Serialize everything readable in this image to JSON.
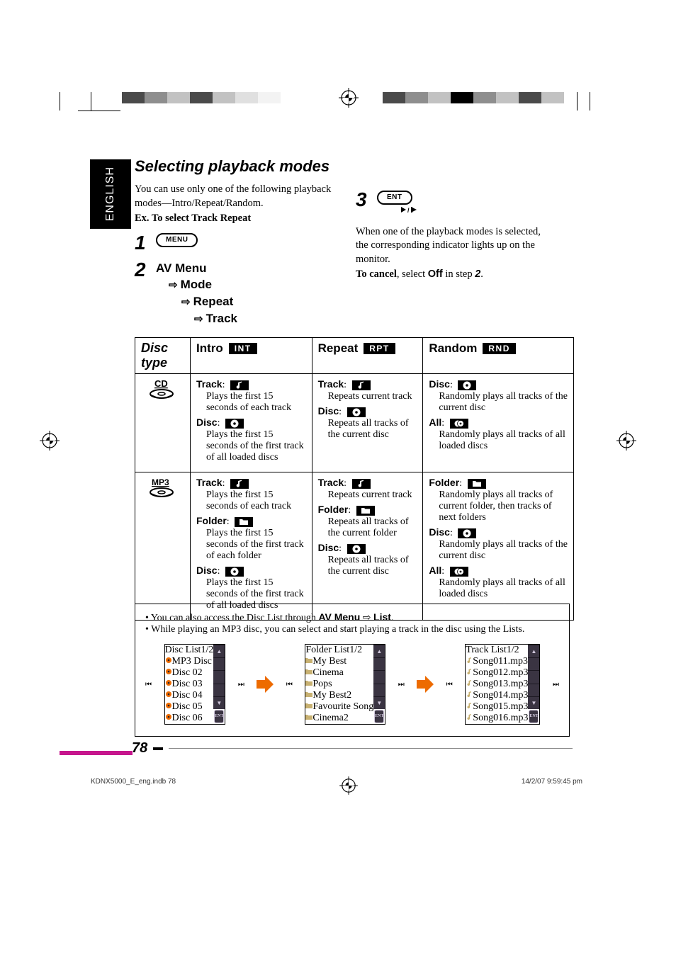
{
  "language_tab": "ENGLISH",
  "section_title": "Selecting playback modes",
  "intro": {
    "line1": "You can use only one of the following playback modes—Intro/Repeat/Random.",
    "example_label": "Ex. To select Track Repeat"
  },
  "steps": {
    "s1": "1",
    "s1_button": "MENU",
    "s2": "2",
    "s2_path": {
      "a": "AV Menu",
      "b": "Mode",
      "c": "Repeat",
      "d": "Track"
    },
    "s3": "3",
    "s3_button": "ENT",
    "s3_note1": "When one of the playback modes is selected, the corresponding indicator lights up on the monitor.",
    "s3_cancel_prefix": "To cancel",
    "s3_cancel_mid": ", select ",
    "s3_cancel_off": "Off",
    "s3_cancel_suffix": " in step ",
    "s3_cancel_step": "2",
    "s3_cancel_period": "."
  },
  "table": {
    "h_disctype": "Disc type",
    "h_intro": "Intro",
    "badge_intro": "INT",
    "h_repeat": "Repeat",
    "badge_repeat": "RPT",
    "h_random": "Random",
    "badge_random": "RND",
    "row_cd": {
      "disclabel": "CD",
      "intro": [
        {
          "label": "Track",
          "desc": "Plays the first 15 seconds of each track",
          "icon": "note"
        },
        {
          "label": "Disc",
          "desc": "Plays the first 15 seconds of the first track of all loaded discs",
          "icon": "disc"
        }
      ],
      "repeat": [
        {
          "label": "Track",
          "desc": "Repeats current track",
          "icon": "note"
        },
        {
          "label": "Disc",
          "desc": "Repeats all tracks of the current disc",
          "icon": "disc"
        }
      ],
      "random": [
        {
          "label": "Disc",
          "desc": "Randomly plays all tracks of the current disc",
          "icon": "disc"
        },
        {
          "label": "All",
          "desc": "Randomly plays all tracks of all loaded discs",
          "icon": "discs"
        }
      ]
    },
    "row_mp3": {
      "disclabel": "MP3",
      "intro": [
        {
          "label": "Track",
          "desc": "Plays the first 15 seconds of each track",
          "icon": "note"
        },
        {
          "label": "Folder",
          "desc": "Plays the first 15 seconds of the first track of each folder",
          "icon": "folder"
        },
        {
          "label": "Disc",
          "desc": "Plays the first 15 seconds of the first track of all loaded discs",
          "icon": "disc"
        }
      ],
      "repeat": [
        {
          "label": "Track",
          "desc": "Repeats current track",
          "icon": "note"
        },
        {
          "label": "Folder",
          "desc": "Repeats all tracks of the current folder",
          "icon": "folder"
        },
        {
          "label": "Disc",
          "desc": "Repeats all tracks of the current disc",
          "icon": "disc"
        }
      ],
      "random": [
        {
          "label": "Folder",
          "desc": "Randomly plays all tracks of current folder, then tracks of next folders",
          "icon": "folder"
        },
        {
          "label": "Disc",
          "desc": "Randomly plays all tracks of the current disc",
          "icon": "disc"
        },
        {
          "label": "All",
          "desc": "Randomly plays all tracks of all loaded discs",
          "icon": "discs"
        }
      ]
    }
  },
  "infobox": {
    "bullet1a": "You can also access the Disc List through ",
    "bullet1b": "AV Menu",
    "bullet1c": " ⇨ ",
    "bullet1d": "List",
    "bullet1e": ".",
    "bullet2": "While playing an MP3 disc, you can select and start playing a track in the disc using the Lists.",
    "lists": {
      "disc": {
        "title": "Disc List",
        "page": "1/2",
        "rows": [
          "MP3 Disc",
          "Disc 02",
          "Disc 03",
          "Disc 04",
          "Disc 05",
          "Disc 06"
        ],
        "active": 0
      },
      "folder": {
        "title": "Folder List",
        "page": "1/2",
        "rows": [
          "My Best",
          "Cinema",
          "Pops",
          "My Best2",
          "Favourite Song",
          "Cinema2"
        ],
        "active": 0
      },
      "track": {
        "title": "Track List",
        "page": "1/2",
        "rows": [
          "Song011.mp3",
          "Song012.mp3",
          "Song013.mp3",
          "Song014.mp3",
          "Song015.mp3",
          "Song016.mp3"
        ],
        "active": 0,
        "sel": 2
      },
      "sidebtn_ent": "ENT",
      "skip_prev": "⏮",
      "skip_next": "⏭"
    }
  },
  "page_number": "78",
  "footer": {
    "left": "KDNX5000_E_eng.indb   78",
    "right": "14/2/07   9:59:45 pm"
  }
}
